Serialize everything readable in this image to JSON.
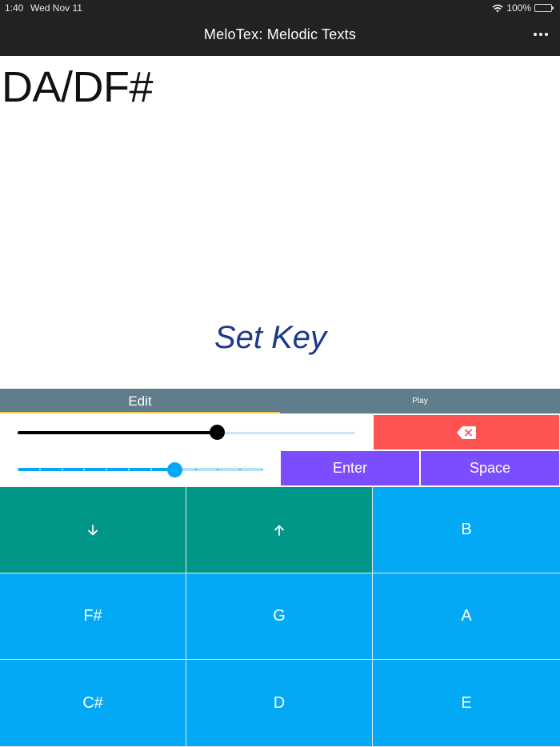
{
  "status_bar": {
    "time": "1:40",
    "date": "Wed Nov 11",
    "battery": "100%"
  },
  "app": {
    "title": "MeloTex: Melodic Texts"
  },
  "content": {
    "text": "DA/DF#",
    "set_key_label": "Set Key"
  },
  "tabs": [
    {
      "label": "Edit",
      "active": true
    },
    {
      "label": "Play",
      "active": false
    }
  ],
  "sliders": {
    "slider_1_value": 0.59,
    "slider_2_value": 0.64,
    "slider_2_steps": 11
  },
  "buttons": {
    "backspace_icon": "backspace-icon",
    "enter": "Enter",
    "space": "Space"
  },
  "keys": [
    {
      "label": "",
      "icon": "arrow-down-icon",
      "color": "#009688"
    },
    {
      "label": "",
      "icon": "arrow-up-icon",
      "color": "#009688"
    },
    {
      "label": "B"
    },
    {
      "label": "F#"
    },
    {
      "label": "G"
    },
    {
      "label": "A"
    },
    {
      "label": "C#"
    },
    {
      "label": "D"
    },
    {
      "label": "E"
    }
  ],
  "colors": {
    "topbar": "#222222",
    "tab_bar": "#607d8b",
    "tab_indicator": "#f2c94c",
    "backspace": "#ff5252",
    "action_buttons": "#7c4dff",
    "note_key": "#03a9f4",
    "arrow_key": "#009688",
    "set_key_text": "#1e3a8a"
  }
}
